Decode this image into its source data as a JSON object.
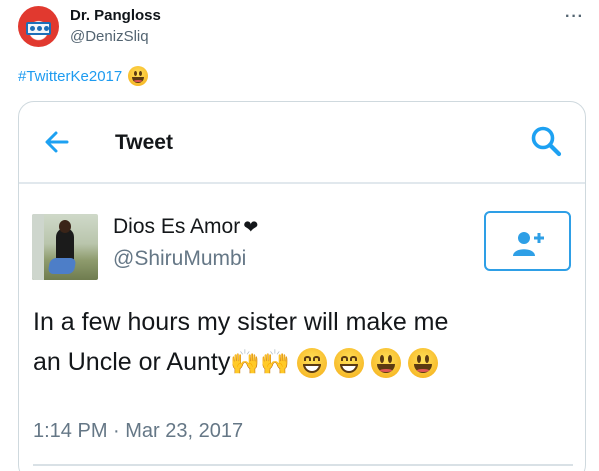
{
  "author": {
    "name": "Dr. Pangloss",
    "handle": "@DenizSliq"
  },
  "more_icon": "more-dots-icon",
  "tweet": {
    "hashtag": "#TwitterKe2017",
    "emoji": "smiley-face-emoji"
  },
  "embedded": {
    "header_title": "Tweet",
    "back_icon": "back-arrow-icon",
    "search_icon": "search-icon",
    "follow_icon": "add-user-icon",
    "author_name": "Dios Es Amor",
    "name_symbol": "❤",
    "author_handle": "@ShiruMumbi",
    "text_line1": "In a few hours my sister will make me",
    "text_line2": "an Uncle or Aunty",
    "text_emojis": [
      "raising-hands",
      "raising-hands",
      "grinning-face",
      "grinning-face",
      "smiley-face",
      "smiley-face"
    ],
    "timestamp": "1:14 PM · Mar 23, 2017"
  },
  "colors": {
    "link": "#1d9bf0",
    "accent": "#2e9fe6",
    "muted": "#536471"
  }
}
